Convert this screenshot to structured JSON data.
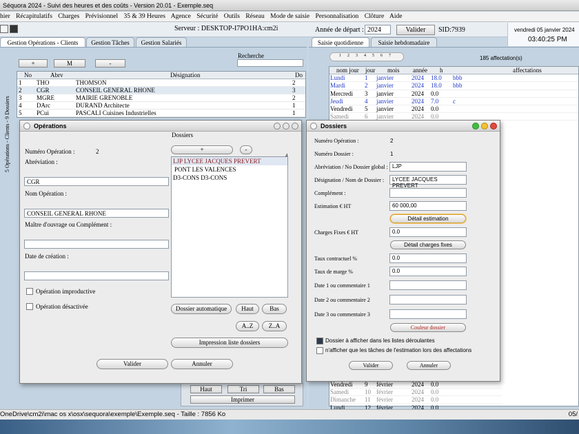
{
  "window": {
    "title": "Séquora 2024 - Suivi des heures et des coûts - Version 20.01 - Exemple.seq"
  },
  "menu": [
    "hier",
    "Récapitulatifs",
    "Charges",
    "Prévisionnel",
    "35 & 39 Heures",
    "Agence",
    "Sécurité",
    "Outils",
    "Réseau",
    "Mode de saisie",
    "Personnalisation",
    "Clôture",
    "Aide"
  ],
  "toolbar": {
    "server_label": "Serveur : DESKTOP-I7PO1HA:cm2i",
    "year_label": "Année de départ :",
    "year_value": "2024",
    "validate": "Valider",
    "sid": "SID:7939",
    "date": "vendredi 05 janvier 2024",
    "time": "03:40:25 PM"
  },
  "left_tabs": [
    "Gestion Opérations - Clients",
    "Gestion Tâches",
    "Gestion Salariés"
  ],
  "right_tabs": [
    "Saisie quotidienne",
    "Saisie hebdomadaire"
  ],
  "left": {
    "search_label": "Recherche",
    "buttons": [
      "+",
      "M",
      "-"
    ],
    "vertical_label": "5 Opérations - Clients - 9 Dossiers",
    "columns": [
      "No",
      "Abrv",
      "Désignation",
      "Do"
    ],
    "rows": [
      {
        "no": "1",
        "abrv": "THO",
        "des": "THOMSON",
        "do": "2"
      },
      {
        "no": "2",
        "abrv": "CGR",
        "des": "CONSEIL GENERAL RHONE",
        "do": "3"
      },
      {
        "no": "3",
        "abrv": "MGRE",
        "des": "MAIRIE GRENOBLE",
        "do": "2"
      },
      {
        "no": "4",
        "abrv": "DArc",
        "des": "DURAND Architecte",
        "do": "1"
      },
      {
        "no": "5",
        "abrv": "PCui",
        "des": "PASCALI Cuisines Industrielles",
        "do": "1"
      }
    ],
    "bottom_buttons": [
      "Haut",
      "Tri",
      "Bas",
      "Imprimer"
    ]
  },
  "right": {
    "page_buttons": [
      "1",
      "2",
      "3",
      "4",
      "5",
      "6",
      "7"
    ],
    "count": "185 affectation(s)",
    "columns": [
      "nom jour",
      "jour",
      "mois",
      "année",
      "h",
      "affectations"
    ],
    "rows": [
      {
        "d": "Lundi",
        "j": "1",
        "m": "janvier",
        "a": "2024",
        "h": "18.0",
        "af": "bbb",
        "c": "blue"
      },
      {
        "d": "Mardi",
        "j": "2",
        "m": "janvier",
        "a": "2024",
        "h": "18.0",
        "af": "bbb",
        "c": "blue"
      },
      {
        "d": "Mercredi",
        "j": "3",
        "m": "janvier",
        "a": "2024",
        "h": "0.0",
        "af": "",
        "c": ""
      },
      {
        "d": "Jeudi",
        "j": "4",
        "m": "janvier",
        "a": "2024",
        "h": "7.0",
        "af": "c",
        "c": "blue"
      },
      {
        "d": "Vendredi",
        "j": "5",
        "m": "janvier",
        "a": "2024",
        "h": "0.0",
        "af": "",
        "c": ""
      },
      {
        "d": "Samedi",
        "j": "6",
        "m": "janvier",
        "a": "2024",
        "h": "0.0",
        "af": "",
        "c": "grey"
      }
    ],
    "bottom_rows": [
      {
        "d": "Vendredi",
        "j": "9",
        "m": "février",
        "a": "2024",
        "h": "0.0",
        "c": ""
      },
      {
        "d": "Samedi",
        "j": "10",
        "m": "février",
        "a": "2024",
        "h": "0.0",
        "c": "grey"
      },
      {
        "d": "Dimanche",
        "j": "11",
        "m": "février",
        "a": "2024",
        "h": "0.0",
        "c": "grey"
      },
      {
        "d": "Lundi",
        "j": "12",
        "m": "février",
        "a": "2024",
        "h": "0.0",
        "c": ""
      }
    ]
  },
  "operations": {
    "title": "Opérations",
    "num_label": "Numéro Opération :",
    "num_value": "2",
    "abrev_label": "Abréviation :",
    "abrev_value": "CGR",
    "nom_label": "Nom Opération :",
    "nom_value": "CONSEIL GENERAL RHONE",
    "maitre_label": "Maître d'ouvrage ou Complément :",
    "maitre_value": "",
    "date_label": "Date de création :",
    "date_value": "",
    "improductive": "Opération improductive",
    "desactivee": "Opération désactivée",
    "dossiers_label": "Dossiers",
    "dossiers_count": "4",
    "dossiers": [
      "LJP LYCEE JACQUES PREVERT",
      "PONT LES VALENCES",
      "D3-CONS D3-CONS"
    ],
    "plus": "+",
    "minus": "-",
    "auto": "Dossier automatique",
    "haut": "Haut",
    "bas": "Bas",
    "az": "A..Z",
    "za": "Z..A",
    "print": "Impression liste dossiers",
    "valider": "Valider",
    "annuler": "Annuler"
  },
  "dossiers": {
    "title": "Dossiers",
    "num_op_label": "Numéro Opération :",
    "num_op_value": "2",
    "num_dos_label": "Numéro Dossier :",
    "num_dos_value": "1",
    "abrev_label": "Abréviation / No Dossier global :",
    "abrev_value": "LJP",
    "designation_label": "Désignation / Nom de Dossier :",
    "designation_value": "LYCEE JACQUES PREVERT",
    "complement_label": "Complément :",
    "complement_value": "",
    "estimation_label": "Estimation € HT",
    "estimation_value": "60 000,00",
    "detail_estimation": "Détail estimation",
    "charges_label": "Charges Fixes € HT",
    "charges_value": "0.0",
    "detail_charges": "Détail charges fixes",
    "taux_contr_label": "Taux contractuel %",
    "taux_contr_value": "0.0",
    "taux_marge_label": "Taux de marge %",
    "taux_marge_value": "0.0",
    "date1_label": "Date 1 ou commentaire 1",
    "date2_label": "Date 2 ou commentaire 2",
    "date3_label": "Date 3 ou commentaire 3",
    "couleur": "Couleur dossier",
    "chk1": "Dossier à afficher dans les listes déroulantes",
    "chk2": "n'afficher que les tâches de l'estimation lors des affectations",
    "valider": "Valider",
    "annuler": "Annuler"
  },
  "status": {
    "path": "OneDrive\\cm2i\\mac  os  x\\osx\\sequora\\exemple\\Exemple.seq   -   Taille : 7856 Ko",
    "right": "05/"
  }
}
